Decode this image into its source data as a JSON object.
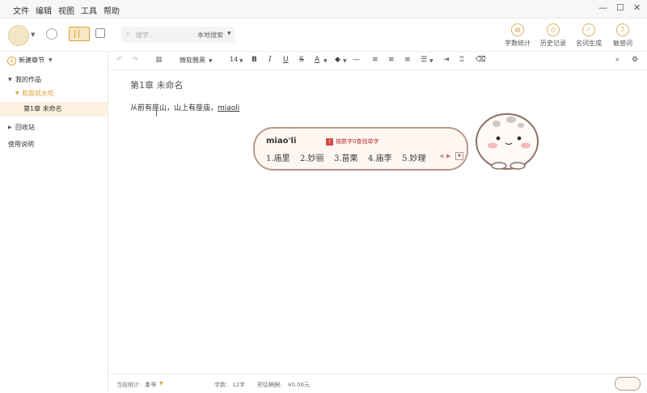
{
  "menu": [
    "文件",
    "编辑",
    "视图",
    "工具",
    "帮助"
  ],
  "search": {
    "placeholder": "搜字...",
    "scope": "本地搜索"
  },
  "toolbar_right": [
    {
      "label": "字数统计",
      "icon": "chart-icon"
    },
    {
      "label": "历史记录",
      "icon": "history-icon"
    },
    {
      "label": "名词生成",
      "icon": "generate-icon"
    },
    {
      "label": "敏感词",
      "icon": "sensitive-icon"
    }
  ],
  "sidebar": {
    "new_chapter": "新建章节",
    "my_works": "我的作品",
    "book": "和面就水吃",
    "chapter": "第1章 未命名",
    "recycle": "回收站",
    "help": "使用说明"
  },
  "format": {
    "font": "微软雅黑",
    "size": "14"
  },
  "editor": {
    "title": "第1章 未命名",
    "body": "从前有座山，山上有座庙，",
    "composing": "miaoli"
  },
  "ime": {
    "composition": "miao'li",
    "tip_badge": "!",
    "tip": "按数字0查找单字",
    "candidates": [
      "1.庙里",
      "2.妙丽",
      "3.苗栗",
      "4.庙李",
      "5.妙理"
    ]
  },
  "status": {
    "scope_label": "当前统计:",
    "scope_value": "本书",
    "count_label": "字数:",
    "count_value": "12字",
    "income_label": "预估稿酬:",
    "income_value": "¥0.06元"
  },
  "colors": {
    "accent": "#d9a43a",
    "selected_bg": "#fbf1de",
    "ime_border": "#b89889"
  }
}
